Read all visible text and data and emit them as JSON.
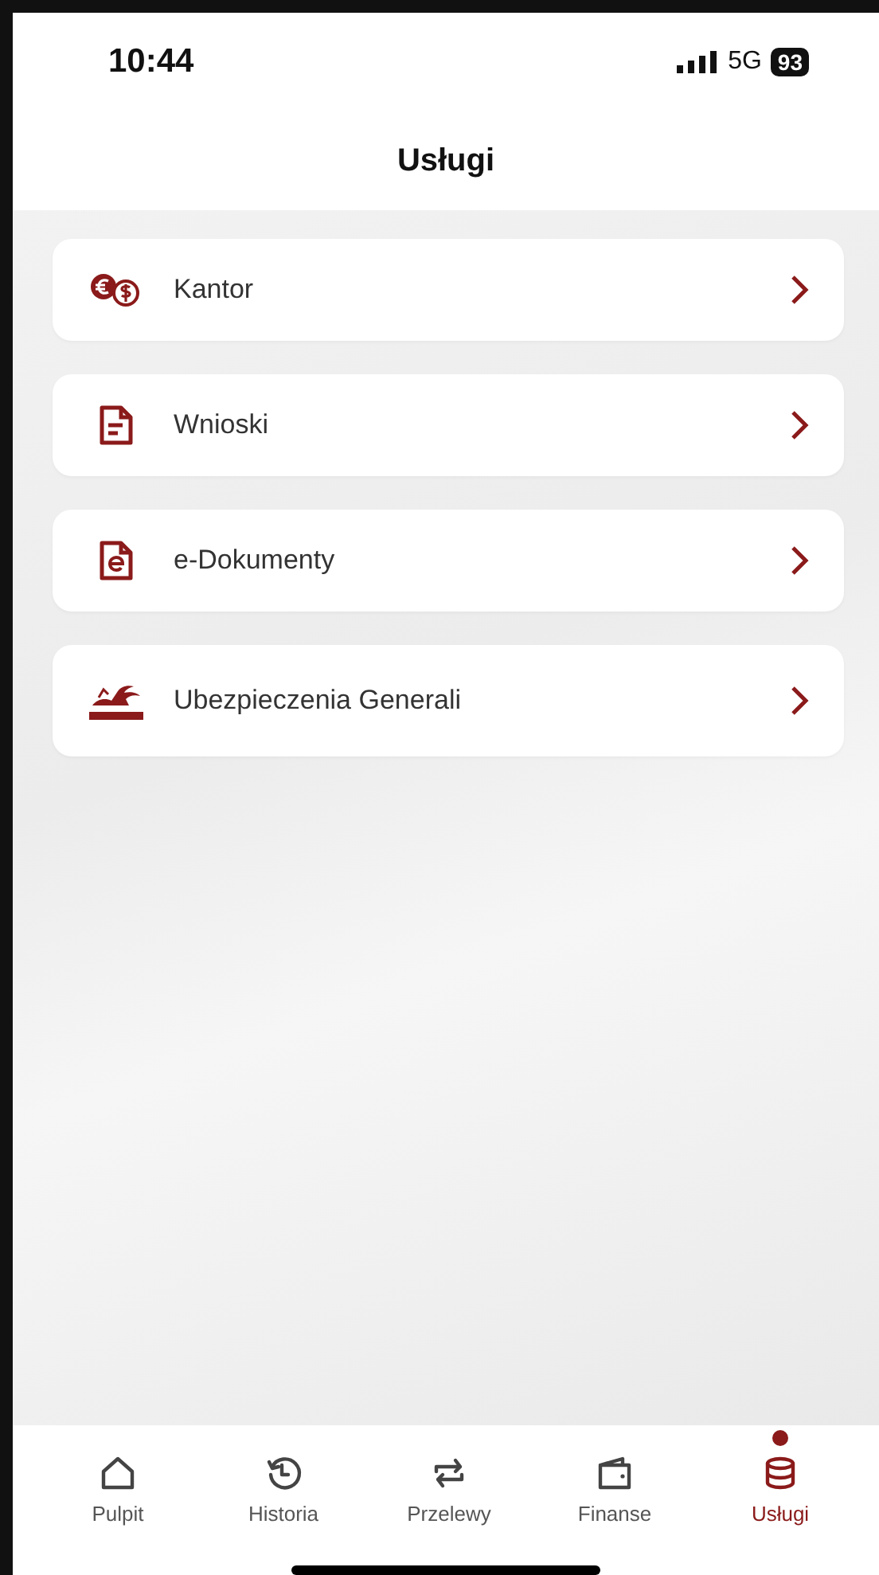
{
  "status_bar": {
    "time": "10:44",
    "network": "5G",
    "battery": "93"
  },
  "header": {
    "title": "Usługi"
  },
  "services": [
    {
      "label": "Kantor",
      "kind": "exchange"
    },
    {
      "label": "Wnioski",
      "kind": "document"
    },
    {
      "label": "e-Dokumenty",
      "kind": "edocument"
    },
    {
      "label": "Ubezpieczenia Generali",
      "kind": "insurer"
    }
  ],
  "tab_bar": {
    "items": [
      {
        "label": "Pulpit",
        "kind": "home",
        "selected": false
      },
      {
        "label": "Historia",
        "kind": "history",
        "selected": false
      },
      {
        "label": "Przelewy",
        "kind": "transfer",
        "selected": false
      },
      {
        "label": "Finanse",
        "kind": "wallet",
        "selected": false
      },
      {
        "label": "Usługi",
        "kind": "services",
        "selected": true
      }
    ]
  }
}
